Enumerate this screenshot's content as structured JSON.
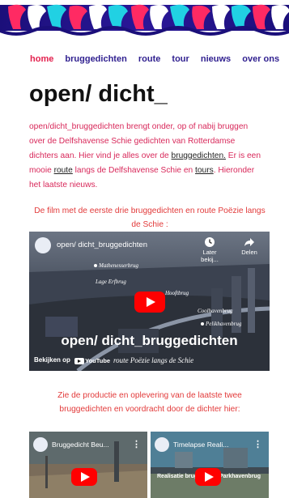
{
  "nav": {
    "items": [
      {
        "label": "home",
        "active": true
      },
      {
        "label": "bruggedichten"
      },
      {
        "label": "route"
      },
      {
        "label": "tour"
      },
      {
        "label": "nieuws"
      },
      {
        "label": "over ons"
      }
    ]
  },
  "title": "open/ dicht_",
  "intro": {
    "part1": "open/dicht_bruggedichten brengt onder, op of nabij bruggen over de Delfshavense Schie gedichten van Rotterdamse dichters aan. Hier vind je alles over de ",
    "link_bruggedichten": "bruggedichten.",
    "part2": " Er is een mooie ",
    "link_route": "route",
    "part3": " langs de Delfshavense Schie en ",
    "link_tours": "tours",
    "part4": ". Hieronder het laatste nieuws."
  },
  "caption1": "De film met de eerste drie bruggedichten en route Poëzie langs de Schie :",
  "video_main": {
    "title": "open/ dicht_bruggedichten",
    "later_label": "Later bekij...",
    "share_label": "Delen",
    "overlay_title": "open/ dicht_bruggedichten",
    "watch_label": "Bekijken op",
    "youtube_label": "YouTube",
    "script_subtitle": "route Poëzie langs de Schie",
    "map_labels": [
      "Mathenesserbrug",
      "Lage Erfbrug",
      "Hooftbrug",
      "Coolhavenbrug",
      "Pelikhavenbrug"
    ]
  },
  "caption2": "Zie de productie en oplevering van de laatste twee bruggedichten en voordracht door de dichter hier:",
  "video_a": {
    "title": "Bruggedicht Beu..."
  },
  "video_b": {
    "title": "Timelapse Reali...",
    "overlay": "Realisatie bruggedicht Parkhavenbrug"
  },
  "colors": {
    "accent": "#e3214e",
    "nav": "#2f1f8f",
    "youtube": "#ff0000"
  }
}
